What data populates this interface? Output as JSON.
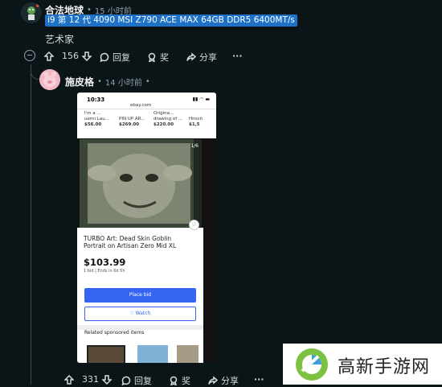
{
  "comment1": {
    "username": "合法地球",
    "time": "15 小时前",
    "flair": "i9 第 12 代 4090 MSI Z790 ACE MAX 64GB DDR5 6400MT/s",
    "text": "艺术家",
    "votes": "156",
    "reply_label": "回复",
    "award_label": "奖",
    "share_label": "分享",
    "more_label": "···"
  },
  "comment2": {
    "username": "施皮格",
    "time": "14 小时前",
    "votes": "331",
    "reply_label": "回复",
    "award_label": "奖",
    "share_label": "分享",
    "more_label": "···"
  },
  "screenshot": {
    "status_time": "10:33",
    "url": "ebay.com",
    "listings": [
      {
        "line1": "I'm a ...",
        "line2": "uerni Lau...",
        "price": "$56.00"
      },
      {
        "line1": "",
        "line2": "PIN UP AR...",
        "price": "$269.00"
      },
      {
        "line1": "Origina...",
        "line2": "drawing of ...",
        "price": "$220.00"
      },
      {
        "line1": "",
        "line2": "Hirsch",
        "price": "$1,5"
      }
    ],
    "image_counter": "1/6",
    "title": "TURBO Art: Dead Skin Goblin Portrait on Artisan Zero Mid XL",
    "price": "$103.99",
    "bids_text": "1 bid | Ends in 6d 5h",
    "place_bid": "Place bid",
    "watch": "♡ Watch",
    "related": "Related sponsored items"
  },
  "watermark": {
    "text": "高新手游网"
  }
}
